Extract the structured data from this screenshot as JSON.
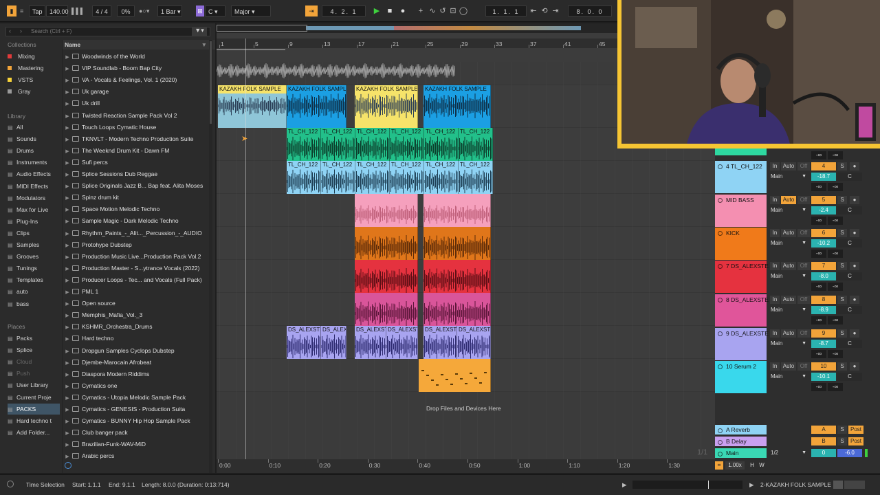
{
  "transport": {
    "tap_label": "Tap",
    "tempo": "140.00",
    "meter": "4 / 4",
    "groove": "0%",
    "quantize": "1 Bar",
    "key": "C",
    "scale": "Major",
    "arrangement_position": "4.  2.  1",
    "loop_start": "1.  1.  1",
    "loop_length": "8.  0.  0"
  },
  "browser": {
    "search_placeholder": "Search (Ctrl + F)",
    "collections_header": "Collections",
    "collections": [
      {
        "label": "Mixing",
        "color": "#e23b3b"
      },
      {
        "label": "Mastering",
        "color": "#f2a43a"
      },
      {
        "label": "VSTS",
        "color": "#f6d23a"
      },
      {
        "label": "Gray",
        "color": "#9a9a9a"
      }
    ],
    "library_header": "Library",
    "library": [
      {
        "label": "All",
        "icon": "all-icon"
      },
      {
        "label": "Sounds",
        "icon": "sounds-icon"
      },
      {
        "label": "Drums",
        "icon": "drums-icon"
      },
      {
        "label": "Instruments",
        "icon": "instruments-icon"
      },
      {
        "label": "Audio Effects",
        "icon": "audio-effects-icon"
      },
      {
        "label": "MIDI Effects",
        "icon": "midi-effects-icon"
      },
      {
        "label": "Modulators",
        "icon": "modulators-icon"
      },
      {
        "label": "Max for Live",
        "icon": "max-icon"
      },
      {
        "label": "Plug-Ins",
        "icon": "plugins-icon"
      },
      {
        "label": "Clips",
        "icon": "clips-icon"
      },
      {
        "label": "Samples",
        "icon": "samples-icon"
      },
      {
        "label": "Grooves",
        "icon": "grooves-icon"
      },
      {
        "label": "Tunings",
        "icon": "tunings-icon"
      },
      {
        "label": "Templates",
        "icon": "templates-icon"
      },
      {
        "label": "auto",
        "icon": "folder-icon"
      },
      {
        "label": "bass",
        "icon": "folder-icon"
      }
    ],
    "places_header": "Places",
    "places": [
      {
        "label": "Packs",
        "icon": "packs-icon"
      },
      {
        "label": "Splice",
        "icon": "splice-icon"
      },
      {
        "label": "Cloud",
        "icon": "cloud-icon"
      },
      {
        "label": "Push",
        "icon": "push-icon"
      },
      {
        "label": "User Library",
        "icon": "user-library-icon"
      },
      {
        "label": "Current Proje",
        "icon": "current-project-icon"
      },
      {
        "label": "PACKS",
        "icon": "folder-icon"
      },
      {
        "label": "Hard techno t",
        "icon": "folder-icon"
      },
      {
        "label": "Add Folder...",
        "icon": "add-folder-icon"
      }
    ],
    "name_header": "Name",
    "files": [
      "Woodwinds of the World",
      "VIP Soundlab - Boom Bap City",
      "VA - Vocals & Feelings, Vol. 1 (2020)",
      "Uk garage",
      "Uk drill",
      "Twisted Reaction Sample Pack Vol 2",
      "Touch Loops Cymatic House",
      "TKNVLT - Modern Techno Production Suite",
      "The Weeknd Drum Kit - Dawn FM",
      "Sufi percs",
      "Splice Sessions Dub Reggae",
      "Splice Originals Jazz B... Bap feat. Alita Moses",
      "Spinz drum kit",
      "Space Motion Melodic Techno",
      "Sample Magic - Dark Melodic Techno",
      "Rhythm_Paints_-_Alit..._Percussion_-_AUDIO",
      "Protohype Dubstep",
      "Production Music Live...Production Pack Vol.2",
      "Production Master - S...ytrance Vocals (2022)",
      "Producer Loops - Tec... and Vocals (Full Pack)",
      "PML 1",
      "Open source",
      "Memphis_Mafia_Vol._3",
      "KSHMR_Orchestra_Drums",
      "Hard techno",
      "Dropgun Samples Cyclops Dubstep",
      "Djembe-Marocain Afrobeat",
      "Diaspora Modern Riddims",
      "Cymatics one",
      "Cymatics - Utopia Melodic Sample Pack",
      "Cymatics - GENESIS - Production Suita",
      "Cymatics - BUNNY Hip Hop Sample Pack",
      "Club banger pack",
      "Brazilian-Funk-WAV-MiD",
      "Arabic percs"
    ]
  },
  "arrangement": {
    "bar_numbers": [
      "1",
      "5",
      "9",
      "13",
      "17",
      "21",
      "25",
      "29",
      "33",
      "37",
      "41",
      "45"
    ],
    "time_labels": [
      "0:00",
      "0:10",
      "0:20",
      "0:30",
      "0:40",
      "0:50",
      "1:00",
      "1:10",
      "1:20",
      "1:30"
    ],
    "drop_zone": "Drop Files and Devices Here",
    "clip_name_kazakh": "KAZAKH FOLK SAMPLE",
    "clip_name_tl": "TL_CH_122",
    "clip_name_ds": "DS_ALEXSTE",
    "clip_name_ds_short": "DS_ALEX"
  },
  "mixer": {
    "tracks": [
      {
        "name": "4 TL_CH_122",
        "color": "#8fd3f4",
        "arm": "In",
        "auto": "Auto",
        "monitor": "Off",
        "num": "4",
        "vol": "-18.7",
        "pan": "C",
        "route": "Main",
        "auto_on": false
      },
      {
        "name": "MID BASS",
        "color": "#f48fb1",
        "arm": "In",
        "auto": "Auto",
        "monitor": "Off",
        "num": "5",
        "vol": "-2.4",
        "pan": "C",
        "route": "Main",
        "auto_on": true
      },
      {
        "name": "KICK",
        "color": "#f07a1a",
        "arm": "In",
        "auto": "Auto",
        "monitor": "Off",
        "num": "6",
        "vol": "-10.2",
        "pan": "C",
        "route": "Main",
        "auto_on": false
      },
      {
        "name": "7 DS_ALEXSTE",
        "color": "#e5323f",
        "arm": "In",
        "auto": "Auto",
        "monitor": "Off",
        "num": "7",
        "vol": "-8.0",
        "pan": "C",
        "route": "Main",
        "auto_on": false
      },
      {
        "name": "8 DS_ALEXSTE",
        "color": "#e0559a",
        "arm": "In",
        "auto": "Auto",
        "monitor": "Off",
        "num": "8",
        "vol": "-8.9",
        "pan": "C",
        "route": "Main",
        "auto_on": false
      },
      {
        "name": "9 DS_ALEXSTE",
        "color": "#a8a4f0",
        "arm": "In",
        "auto": "Auto",
        "monitor": "Off",
        "num": "9",
        "vol": "-8.7",
        "pan": "C",
        "route": "Main",
        "auto_on": false
      },
      {
        "name": "10 Serum 2",
        "color": "#39d8ec",
        "arm": "In",
        "auto": "Auto",
        "monitor": "Off",
        "num": "10",
        "vol": "-10.1",
        "pan": "C",
        "route": "Main",
        "auto_on": false
      }
    ],
    "send_inf": "-∞",
    "returns": [
      {
        "name": "A Reverb",
        "color": "#8fd3f4",
        "letter": "A",
        "solo": "S",
        "post": "Post"
      },
      {
        "name": "B Delay",
        "color": "#c9a0f0",
        "letter": "B",
        "solo": "S",
        "post": "Post"
      }
    ],
    "main": {
      "name": "Main",
      "color": "#3ad8b4",
      "route": "1/2",
      "num": "0",
      "vol": "-6.0"
    },
    "page_indicator": "1/1",
    "zoom": "1.00x",
    "h_label": "H",
    "w_label": "W"
  },
  "status": {
    "selection_title": "Time Selection",
    "start": "Start: 1.1.1",
    "end": "End: 9.1.1",
    "length": "Length: 8.0.0 (Duration: 0:13:714)",
    "clip_name": "2-KAZAKH FOLK SAMPLE"
  }
}
